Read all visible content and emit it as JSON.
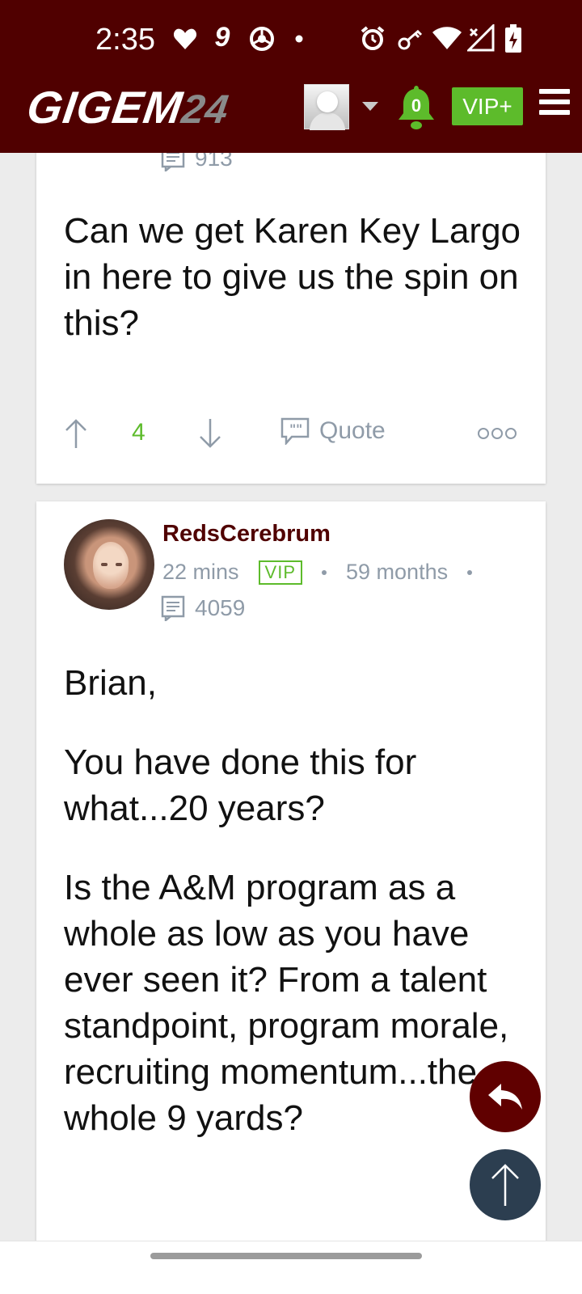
{
  "status_bar": {
    "time": "2:35",
    "icons": [
      "heart-icon",
      "nine-icon",
      "chrome-icon",
      "dot-icon",
      "alarm-icon",
      "key-icon",
      "wifi-icon",
      "signal-off-icon",
      "battery-charging-icon"
    ]
  },
  "header": {
    "logo_main": "GIGEM",
    "logo_num": "24",
    "notification_count": "0",
    "vip_label": "VIP+",
    "colors": {
      "maroon": "#500000",
      "green": "#5dbb2b"
    }
  },
  "post1": {
    "post_count": "913",
    "body": "Can we get Karen Key Largo in here to give us the spin on this?",
    "votes": "4",
    "quote_label": "Quote"
  },
  "post2": {
    "username": "RedsCerebrum",
    "time_ago": "22 mins",
    "badge": "VIP",
    "membership": "59 months",
    "post_count": "4059",
    "paragraphs": [
      "Brian,",
      "You have done this for what...20 years?",
      "Is the A&M program as a whole as low as you have ever seen it? From a talent standpoint, program morale, recruiting momentum...the whole 9 yards?"
    ]
  }
}
